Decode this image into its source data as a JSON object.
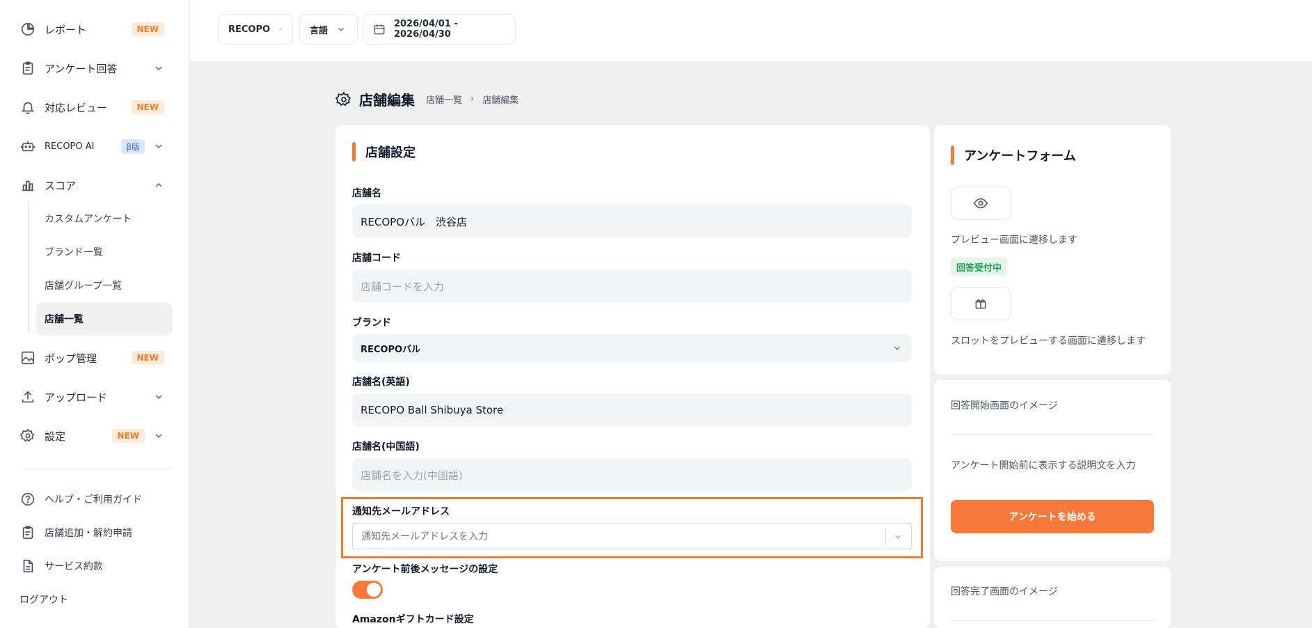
{
  "sidebar": {
    "items": [
      {
        "label": "レポート",
        "badge": "NEW",
        "icon": "chart-pie-icon"
      },
      {
        "label": "アンケート回答",
        "icon": "clipboard-icon"
      },
      {
        "label": "対応レビュー",
        "badge": "NEW",
        "icon": "bell-icon"
      },
      {
        "label": "RECOPO AI",
        "badge": "β版",
        "icon": "robot-icon"
      },
      {
        "label": "スコア",
        "icon": "bar-chart-icon"
      }
    ],
    "score_sub": [
      {
        "label": "カスタムアンケート"
      },
      {
        "label": "ブランド一覧"
      },
      {
        "label": "店舗グループ一覧"
      },
      {
        "label": "店舗一覧"
      }
    ],
    "items2": [
      {
        "label": "ポップ管理",
        "badge": "NEW",
        "icon": "image-icon"
      },
      {
        "label": "アップロード",
        "icon": "upload-icon"
      },
      {
        "label": "設定",
        "badge": "NEW",
        "icon": "gear-icon"
      }
    ],
    "bottom": [
      {
        "label": "ヘルプ・ご利用ガイド",
        "icon": "help-icon"
      },
      {
        "label": "店舗追加・解約申請",
        "icon": "clipboard-icon"
      },
      {
        "label": "サービス約款",
        "icon": "document-icon"
      },
      {
        "label": "ログアウト"
      }
    ]
  },
  "topbar": {
    "company": "RECOPO",
    "language": "言語",
    "date_range": "2026/04/01 - 2026/04/30"
  },
  "page": {
    "title": "店舗編集",
    "breadcrumb": [
      "店舗一覧",
      "店舗編集"
    ]
  },
  "form": {
    "section_title": "店舗設定",
    "store_name_label": "店舗名",
    "store_name_value": "RECOPOバル　渋谷店",
    "store_code_label": "店舗コード",
    "store_code_placeholder": "店舗コードを入力",
    "brand_label": "ブランド",
    "brand_value": "RECOPOバル",
    "name_en_label": "店舗名(英語)",
    "name_en_value": "RECOPO Ball Shibuya Store",
    "name_zh_label": "店舗名(中国語)",
    "name_zh_placeholder": "店舗名を入力(中国語)",
    "email_label": "通知先メールアドレス",
    "email_placeholder": "通知先メールアドレスを入力",
    "message_label": "アンケート前後メッセージの設定",
    "message_toggle_on": true,
    "amazon_label": "Amazonギフトカード設定"
  },
  "survey_form": {
    "title": "アンケートフォーム",
    "preview_text": "プレビュー画面に遷移します",
    "status": "回答受付中",
    "slot_text": "スロットをプレビューする画面に遷移します"
  },
  "start_image": {
    "label": "回答開始画面のイメージ",
    "description": "アンケート開始前に表示する説明文を入力",
    "button": "アンケートを始める"
  },
  "complete_image": {
    "label": "回答完了画面のイメージ"
  },
  "colors": {
    "accent": "#f7793a",
    "highlight": "#f07b2c",
    "status_green": "#1e9e4f"
  }
}
